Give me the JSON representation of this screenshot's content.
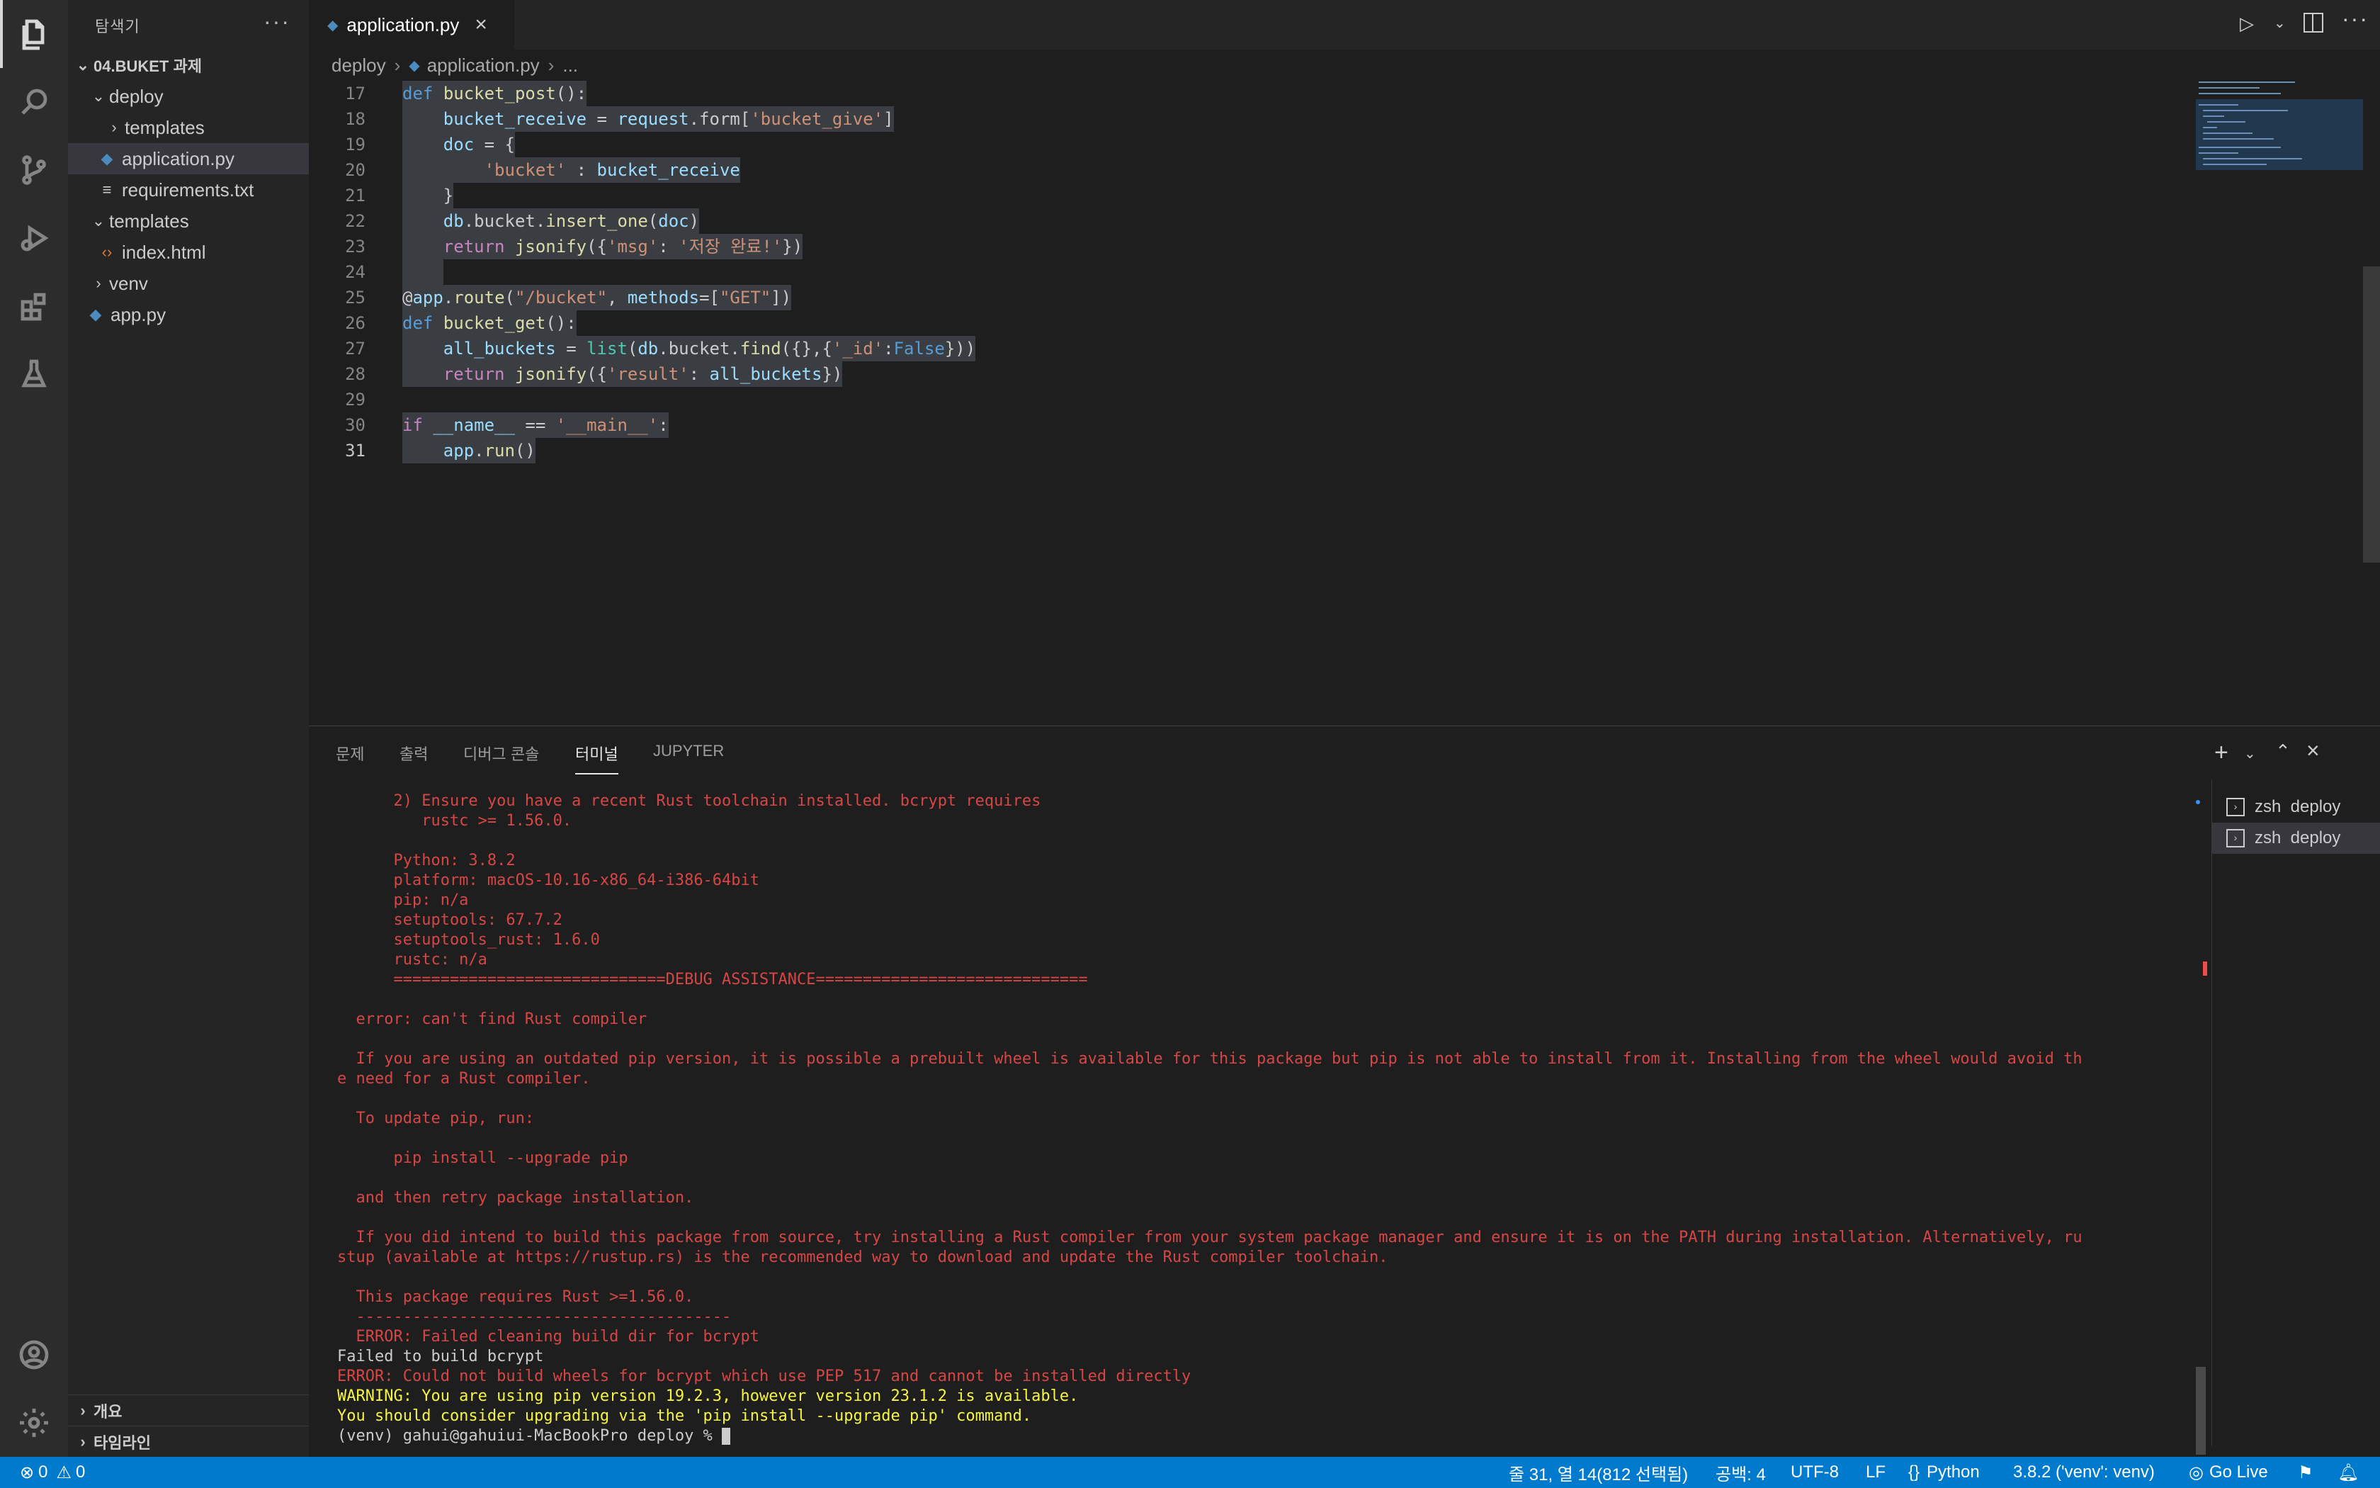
{
  "explorer": {
    "title": "탐색기",
    "more": "···",
    "workspace": "04.BUKET 과제",
    "items": [
      {
        "label": "deploy",
        "kind": "folder-open"
      },
      {
        "label": "templates",
        "kind": "folder"
      },
      {
        "label": "application.py",
        "kind": "python"
      },
      {
        "label": "requirements.txt",
        "kind": "text"
      },
      {
        "label": "templates",
        "kind": "folder-open"
      },
      {
        "label": "index.html",
        "kind": "html"
      },
      {
        "label": "venv",
        "kind": "folder"
      },
      {
        "label": "app.py",
        "kind": "python"
      }
    ],
    "outline": "개요",
    "timeline": "타임라인"
  },
  "tab": {
    "label": "application.py",
    "close": "×"
  },
  "breadcrumb": {
    "folder": "deploy",
    "file": "application.py",
    "more": "..."
  },
  "code": {
    "lines": [
      {
        "n": "17",
        "t": "def bucket_post():"
      },
      {
        "n": "18",
        "t": "    bucket_receive = request.form['bucket_give']"
      },
      {
        "n": "19",
        "t": "    doc = {"
      },
      {
        "n": "20",
        "t": "        'bucket' : bucket_receive"
      },
      {
        "n": "21",
        "t": "    }"
      },
      {
        "n": "22",
        "t": "    db.bucket.insert_one(doc)"
      },
      {
        "n": "23",
        "t": "    return jsonify({'msg': '저장 완료!'})"
      },
      {
        "n": "24",
        "t": "    "
      },
      {
        "n": "25",
        "t": "@app.route(\"/bucket\", methods=[\"GET\"])"
      },
      {
        "n": "26",
        "t": "def bucket_get():"
      },
      {
        "n": "27",
        "t": "    all_buckets = list(db.bucket.find({},{'_id':False}))"
      },
      {
        "n": "28",
        "t": "    return jsonify({'result': all_buckets})"
      },
      {
        "n": "29",
        "t": ""
      },
      {
        "n": "30",
        "t": "if __name__ == '__main__':"
      },
      {
        "n": "31",
        "t": "    app.run()"
      }
    ]
  },
  "panel": {
    "tabs": [
      "문제",
      "출력",
      "디버그 콘솔",
      "터미널",
      "JUPYTER"
    ],
    "active_tab": "터미널",
    "terminals": [
      "zsh  deploy",
      "zsh  deploy"
    ]
  },
  "terminal": {
    "lines": [
      {
        "c": "red",
        "t": "      2) Ensure you have a recent Rust toolchain installed. bcrypt requires"
      },
      {
        "c": "red",
        "t": "         rustc >= 1.56.0."
      },
      {
        "c": "red",
        "t": ""
      },
      {
        "c": "red",
        "t": "      Python: 3.8.2"
      },
      {
        "c": "red",
        "t": "      platform: macOS-10.16-x86_64-i386-64bit"
      },
      {
        "c": "red",
        "t": "      pip: n/a"
      },
      {
        "c": "red",
        "t": "      setuptools: 67.7.2"
      },
      {
        "c": "red",
        "t": "      setuptools_rust: 1.6.0"
      },
      {
        "c": "red",
        "t": "      rustc: n/a"
      },
      {
        "c": "red",
        "t": "      =============================DEBUG ASSISTANCE============================="
      },
      {
        "c": "red",
        "t": ""
      },
      {
        "c": "red",
        "t": "  error: can't find Rust compiler"
      },
      {
        "c": "red",
        "t": ""
      },
      {
        "c": "red",
        "t": "  If you are using an outdated pip version, it is possible a prebuilt wheel is available for this package but pip is not able to install from it. Installing from the wheel would avoid th"
      },
      {
        "c": "red",
        "t": "e need for a Rust compiler."
      },
      {
        "c": "red",
        "t": ""
      },
      {
        "c": "red",
        "t": "  To update pip, run:"
      },
      {
        "c": "red",
        "t": ""
      },
      {
        "c": "red",
        "t": "      pip install --upgrade pip"
      },
      {
        "c": "red",
        "t": ""
      },
      {
        "c": "red",
        "t": "  and then retry package installation."
      },
      {
        "c": "red",
        "t": ""
      },
      {
        "c": "red",
        "t": "  If you did intend to build this package from source, try installing a Rust compiler from your system package manager and ensure it is on the PATH during installation. Alternatively, ru"
      },
      {
        "c": "red",
        "t": "stup (available at https://rustup.rs) is the recommended way to download and update the Rust compiler toolchain."
      },
      {
        "c": "red",
        "t": ""
      },
      {
        "c": "red",
        "t": "  This package requires Rust >=1.56.0."
      },
      {
        "c": "red",
        "t": "  ----------------------------------------"
      },
      {
        "c": "red",
        "t": "  ERROR: Failed cleaning build dir for bcrypt"
      },
      {
        "c": "wht",
        "t": "Failed to build bcrypt"
      },
      {
        "c": "red",
        "t": "ERROR: Could not build wheels for bcrypt which use PEP 517 and cannot be installed directly"
      },
      {
        "c": "yel",
        "t": "WARNING: You are using pip version 19.2.3, however version 23.1.2 is available."
      },
      {
        "c": "yel",
        "t": "You should consider upgrading via the 'pip install --upgrade pip' command."
      }
    ],
    "prompt": "(venv) gahui@gahuiui-MacBookPro deploy % "
  },
  "status": {
    "errors": "0",
    "warnings": "0",
    "position": "줄 31, 열 14(812 선택됨)",
    "spaces": "공백: 4",
    "encoding": "UTF-8",
    "eol": "LF",
    "language": "Python",
    "interpreter": "3.8.2 ('venv': venv)",
    "golive": "Go Live"
  }
}
